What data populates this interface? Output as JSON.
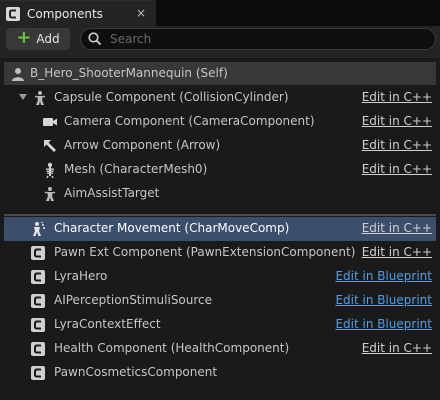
{
  "tab": {
    "title": "Components",
    "close_glyph": "×"
  },
  "toolbar": {
    "add_label": "Add",
    "search_placeholder": "Search"
  },
  "root": {
    "label": "B_Hero_ShooterMannequin (Self)"
  },
  "components": [
    {
      "label": "Capsule Component (CollisionCylinder)",
      "edit": "Edit in C++",
      "edit_kind": "cpp",
      "icon": "capsule-icon"
    },
    {
      "label": "Camera Component (CameraComponent)",
      "edit": "Edit in C++",
      "edit_kind": "cpp",
      "icon": "camera-icon"
    },
    {
      "label": "Arrow Component (Arrow)",
      "edit": "Edit in C++",
      "edit_kind": "cpp",
      "icon": "arrow-icon"
    },
    {
      "label": "Mesh (CharacterMesh0)",
      "edit": "Edit in C++",
      "edit_kind": "cpp",
      "icon": "skeleton-icon"
    },
    {
      "label": "AimAssistTarget",
      "edit": "",
      "edit_kind": "",
      "icon": "capsule-icon"
    }
  ],
  "actor_components": [
    {
      "label": "Character Movement (CharMoveComp)",
      "edit": "Edit in C++",
      "edit_kind": "cpp",
      "icon": "movement-icon",
      "selected": true
    },
    {
      "label": "Pawn Ext Component (PawnExtensionComponent)",
      "edit": "Edit in C++",
      "edit_kind": "cpp",
      "icon": "component-icon"
    },
    {
      "label": "LyraHero",
      "edit": "Edit in Blueprint",
      "edit_kind": "bp",
      "icon": "component-icon"
    },
    {
      "label": "AIPerceptionStimuliSource",
      "edit": "Edit in Blueprint",
      "edit_kind": "bp",
      "icon": "component-icon"
    },
    {
      "label": "LyraContextEffect",
      "edit": "Edit in Blueprint",
      "edit_kind": "bp",
      "icon": "component-icon"
    },
    {
      "label": "Health Component (HealthComponent)",
      "edit": "Edit in C++",
      "edit_kind": "cpp",
      "icon": "component-icon"
    },
    {
      "label": "PawnCosmeticsComponent",
      "edit": "",
      "edit_kind": "",
      "icon": "component-icon"
    }
  ],
  "colors": {
    "accent_green": "#6fbf3f",
    "selection": "#3b4e6b",
    "blueprint_link": "#4f9fe8"
  }
}
